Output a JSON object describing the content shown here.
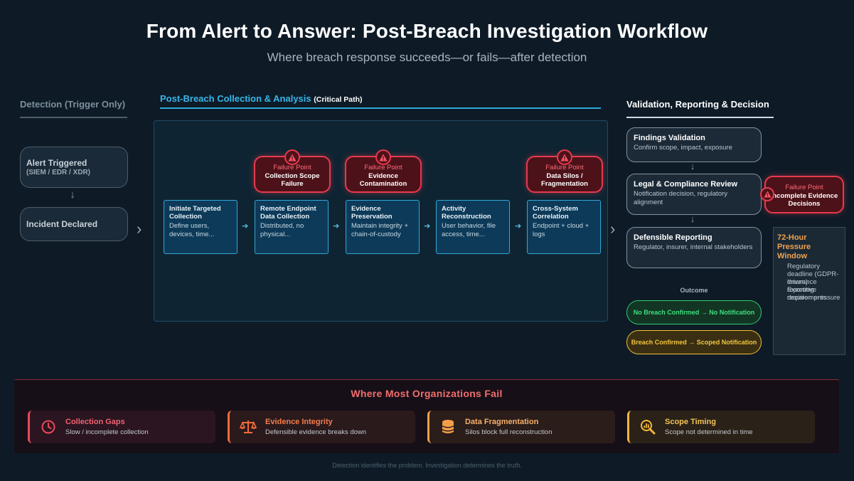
{
  "header": {
    "title": "From Alert to Answer: Post-Breach Investigation Workflow",
    "subtitle": "Where breach response succeeds—or fails—after detection"
  },
  "sections": {
    "detection": "Detection (Trigger Only)",
    "collection": "Post-Breach Collection & Analysis",
    "collection_note": "(Critical Path)",
    "validation": "Validation, Reporting & Decision"
  },
  "detection": {
    "alert_title": "Alert Triggered",
    "alert_sub": "(SIEM / EDR / XDR)",
    "incident": "Incident Declared"
  },
  "steps": [
    {
      "title": "Initiate Targeted Collection",
      "desc": "Define users, devices, time..."
    },
    {
      "title": "Remote Endpoint Data Collection",
      "desc": "Distributed, no physical..."
    },
    {
      "title": "Evidence Preservation",
      "desc": "Maintain integrity + chain-of-custody"
    },
    {
      "title": "Activity Reconstruction",
      "desc": "User behavior, file access, time..."
    },
    {
      "title": "Cross-System Correlation",
      "desc": "Endpoint + cloud + logs"
    }
  ],
  "failures": [
    {
      "label": "Failure Point",
      "title": "Collection Scope Failure"
    },
    {
      "label": "Failure Point",
      "title": "Evidence Contamination"
    },
    {
      "label": "Failure Point",
      "title": "Data Silos / Fragmentation"
    },
    {
      "label": "Failure Point",
      "title": "Incomplete Evidence Decisions"
    }
  ],
  "validation": [
    {
      "title": "Findings Validation",
      "desc": "Confirm scope, impact, exposure"
    },
    {
      "title": "Legal & Compliance Review",
      "desc": "Notification decision, regulatory alignment"
    },
    {
      "title": "Defensible Reporting",
      "desc": "Regulator, insurer, internal stakeholders"
    }
  ],
  "outcome": {
    "label": "Outcome",
    "negative": "No Breach Confirmed → No Notification",
    "positive": "Breach Confirmed → Scoped Notification"
  },
  "pressure": {
    "title": "72-Hour Pressure Window",
    "items": [
      "Regulatory deadline (GDPR-driven)",
      "Insurance reporting requirements",
      "Executive decision pressure"
    ]
  },
  "bottom": {
    "heading": "Where Most Organizations Fail",
    "cards": [
      {
        "title": "Collection Gaps",
        "desc": "Slow / incomplete collection",
        "icon": "clock-icon",
        "color": "#e8495d"
      },
      {
        "title": "Evidence Integrity",
        "desc": "Defensible evidence breaks down",
        "icon": "scales-icon",
        "color": "#f26b3a"
      },
      {
        "title": "Data Fragmentation",
        "desc": "Silos block full reconstruction",
        "icon": "database-icon",
        "color": "#f5a04a"
      },
      {
        "title": "Scope Timing",
        "desc": "Scope not determined in time",
        "icon": "magnifier-chart-icon",
        "color": "#f3b63e"
      }
    ]
  },
  "footer": "Detection identifies the problem. Investigation determines the truth.",
  "colors": {
    "accent_blue": "#2fa8d8",
    "failure_red": "#e63a4e",
    "outcome_green": "#2ecc71",
    "outcome_amber": "#f1c232",
    "pressure_orange": "#f0a24e"
  }
}
